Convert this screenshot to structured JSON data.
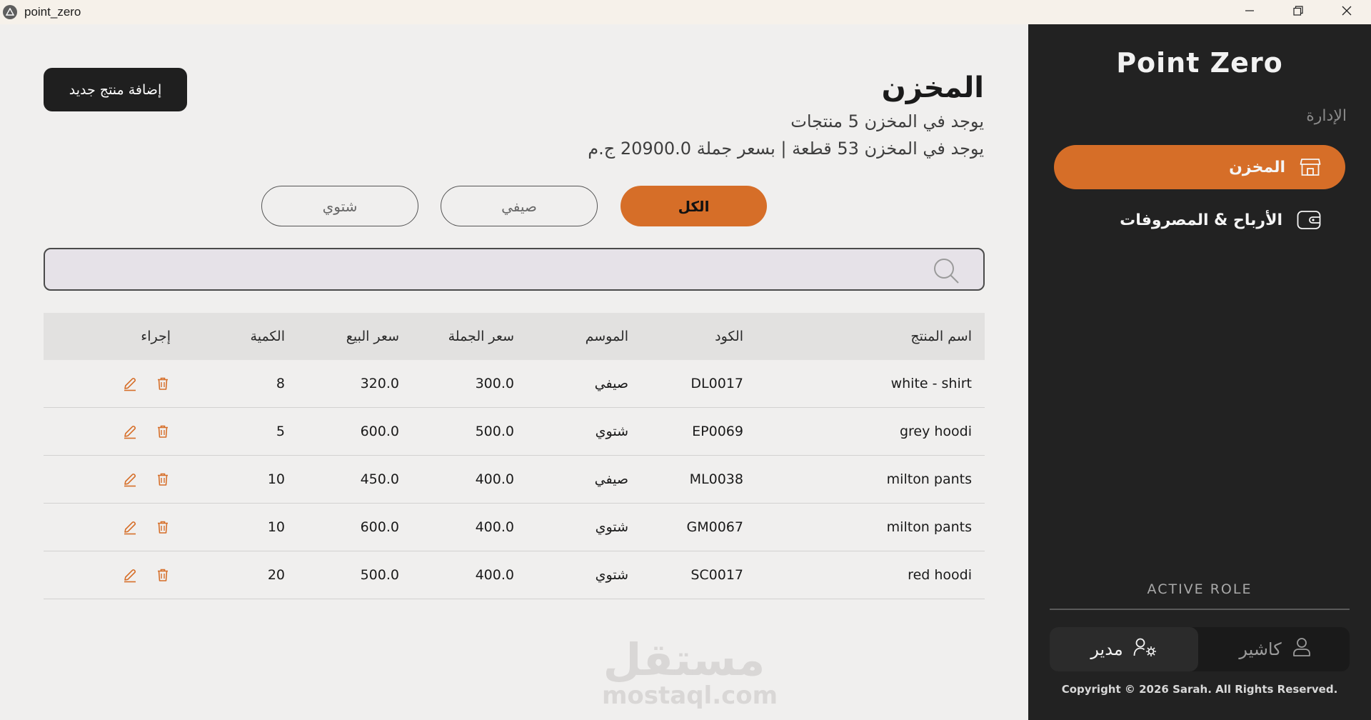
{
  "window": {
    "title": "point_zero",
    "controls": [
      "minimize-icon",
      "restore-icon",
      "close-icon"
    ]
  },
  "main": {
    "title": "المخزن",
    "summary_products": "يوجد في المخزن 5 منتجات",
    "summary_stock": "يوجد في المخزن 53 قطعة | بسعر جملة 20900.0 ج.م",
    "add_button": "إضافة منتج جديد",
    "filters": {
      "all": "الكل",
      "summer": "صيفي",
      "winter": "شتوي",
      "active": "all"
    },
    "search": {
      "placeholder": "",
      "value": ""
    },
    "table": {
      "headers": {
        "name": "اسم المنتج",
        "code": "الكود",
        "season": "الموسم",
        "wholesale": "سعر الجملة",
        "sale": "سعر البيع",
        "quantity": "الكمية",
        "action": "إجراء"
      },
      "rows": [
        {
          "name": "white - shirt",
          "code": "DL0017",
          "season": "صيفي",
          "wholesale": "300.0",
          "sale": "320.0",
          "quantity": "8"
        },
        {
          "name": "grey hoodi",
          "code": "EP0069",
          "season": "شتوي",
          "wholesale": "500.0",
          "sale": "600.0",
          "quantity": "5"
        },
        {
          "name": "milton pants",
          "code": "ML0038",
          "season": "صيفي",
          "wholesale": "400.0",
          "sale": "450.0",
          "quantity": "10"
        },
        {
          "name": "milton pants",
          "code": "GM0067",
          "season": "شتوي",
          "wholesale": "400.0",
          "sale": "600.0",
          "quantity": "10"
        },
        {
          "name": "red hoodi",
          "code": "SC0017",
          "season": "شتوي",
          "wholesale": "400.0",
          "sale": "500.0",
          "quantity": "20"
        }
      ]
    },
    "watermark": {
      "arabic": "مستقل",
      "latin": "mostaql.com"
    }
  },
  "sidebar": {
    "brand": "Point Zero",
    "section_label": "الإدارة",
    "items": [
      {
        "label": "المخزن",
        "icon": "store-icon",
        "active": true
      },
      {
        "label": "الأرباح & المصروفات",
        "icon": "wallet-icon",
        "active": false
      }
    ],
    "role_label": "ACTIVE ROLE",
    "roles": {
      "manager": "مدير",
      "cashier": "كاشير",
      "active": "manager"
    },
    "copyright": "Copyright © 2026 Sarah. All Rights Reserved."
  },
  "colors": {
    "accent": "#d66e28",
    "sidebar_bg": "#222222",
    "main_bg": "#f0efee",
    "dark_button": "#1f1f1f"
  }
}
